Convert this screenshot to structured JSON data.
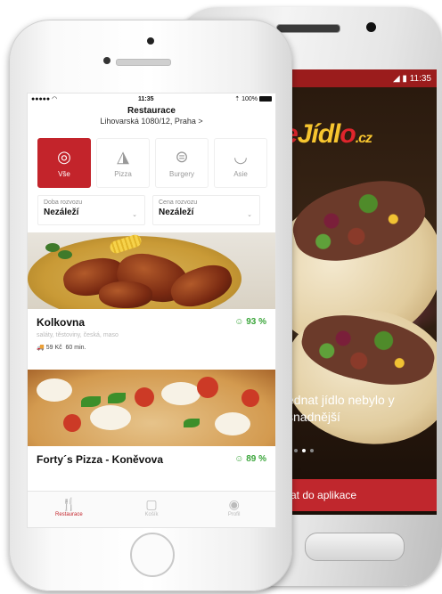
{
  "android": {
    "status_time": "11:35",
    "status_icons": "◢ ▮",
    "logo_prefix": "e",
    "logo_main": "Jídl",
    "logo_o": "o",
    "logo_suffix": ".cz",
    "tagline": "ednat jídlo nebylo y snadnější",
    "cta_button": "vat do aplikace"
  },
  "iphone": {
    "status": {
      "carrier": "●●●●● ",
      "wifi": "◠",
      "time": "11:35",
      "battery_text": "⇡ 100%"
    },
    "header": {
      "title": "Restaurace",
      "address": "Lihovarská 1080/12, Praha >"
    },
    "categories": [
      {
        "label": "Vše",
        "icon": "◎",
        "icon_name": "all-icon"
      },
      {
        "label": "Pizza",
        "icon": "◮",
        "icon_name": "pizza-icon"
      },
      {
        "label": "Burgery",
        "icon": "⊜",
        "icon_name": "burger-icon"
      },
      {
        "label": "Asie",
        "icon": "◡",
        "icon_name": "bowl-icon"
      }
    ],
    "filters": [
      {
        "label": "Doba rozvozu",
        "value": "Nezáleží"
      },
      {
        "label": "Cena rozvozu",
        "value": "Nezáleží"
      }
    ],
    "restaurants": [
      {
        "name": "Kolkovna",
        "rating": "93 %",
        "tags": "saláty, těstoviny, česká, maso",
        "delivery_price": "59 Kč",
        "delivery_time": "60 min."
      },
      {
        "name": "Forty´s Pizza - Koněvova",
        "rating": "89 %"
      }
    ],
    "tabs": [
      {
        "label": "Restaurace",
        "icon": "🍴"
      },
      {
        "label": "Košík",
        "icon": "▢"
      },
      {
        "label": "Profil",
        "icon": "◉"
      }
    ]
  },
  "colors": {
    "brand_red": "#c3242b",
    "rating_green": "#3aa53a"
  }
}
